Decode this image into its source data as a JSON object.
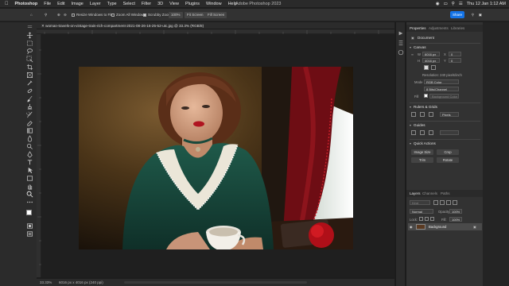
{
  "menubar": {
    "apple_icon": "apple-icon",
    "app": "Photoshop",
    "items": [
      "File",
      "Edit",
      "Image",
      "Layer",
      "Type",
      "Select",
      "Filter",
      "3D",
      "View",
      "Plugins",
      "Window",
      "Help"
    ],
    "center_title": "Adobe Photoshop 2023",
    "clock": "Thu 12 Jan  1:12 AM"
  },
  "options": {
    "resize_windows": "Resize Windows to Fit",
    "zoom_all": "Zoom All Windows",
    "scrubby_zoom": "Scrubby Zoom",
    "zoom_100": "100%",
    "fit_screen": "Fit Screen",
    "fill_screen": "Fill Screen",
    "share": "Share"
  },
  "document": {
    "tab_title": "woman-travels-on-vintage-train-rich-compartment-2021-08-26-16-25-52-utc.jpg @ 33.3% (RGB/8)",
    "zoom": "33.33%",
    "doc_size": "6016 px x 4016 px (240 ppi)"
  },
  "panel": {
    "tabs": [
      "Properties",
      "Adjustments",
      "Libraries"
    ],
    "doc_label": "Document",
    "canvas": {
      "title": "Canvas",
      "w_label": "W",
      "w_value": "6016 px",
      "h_label": "H",
      "h_value": "4016 px",
      "x_label": "X",
      "x_value": "0",
      "y_label": "Y",
      "y_value": "0",
      "resolution": "Resolution: 240 pixels/inch",
      "mode_label": "Mode",
      "mode_value": "RGB Color",
      "bit_value": "8 Bits/Channel",
      "fill_label": "Fill",
      "fill_value": "Background Color"
    },
    "rulers": {
      "title": "Rulers & Grids",
      "unit": "Pixels"
    },
    "guides": {
      "title": "Guides"
    },
    "quick_actions": {
      "title": "Quick Actions",
      "image_size": "Image Size",
      "crop": "Crop",
      "trim": "Trim",
      "rotate": "Rotate"
    },
    "layers": {
      "tabs": [
        "Layers",
        "Channels",
        "Paths"
      ],
      "kind_placeholder": "Kind",
      "blend_mode": "Normal",
      "opacity_label": "Opacity:",
      "opacity_value": "100%",
      "lock_label": "Lock:",
      "fill_label": "Fill:",
      "fill_value": "100%",
      "layer_name": "Background"
    }
  }
}
